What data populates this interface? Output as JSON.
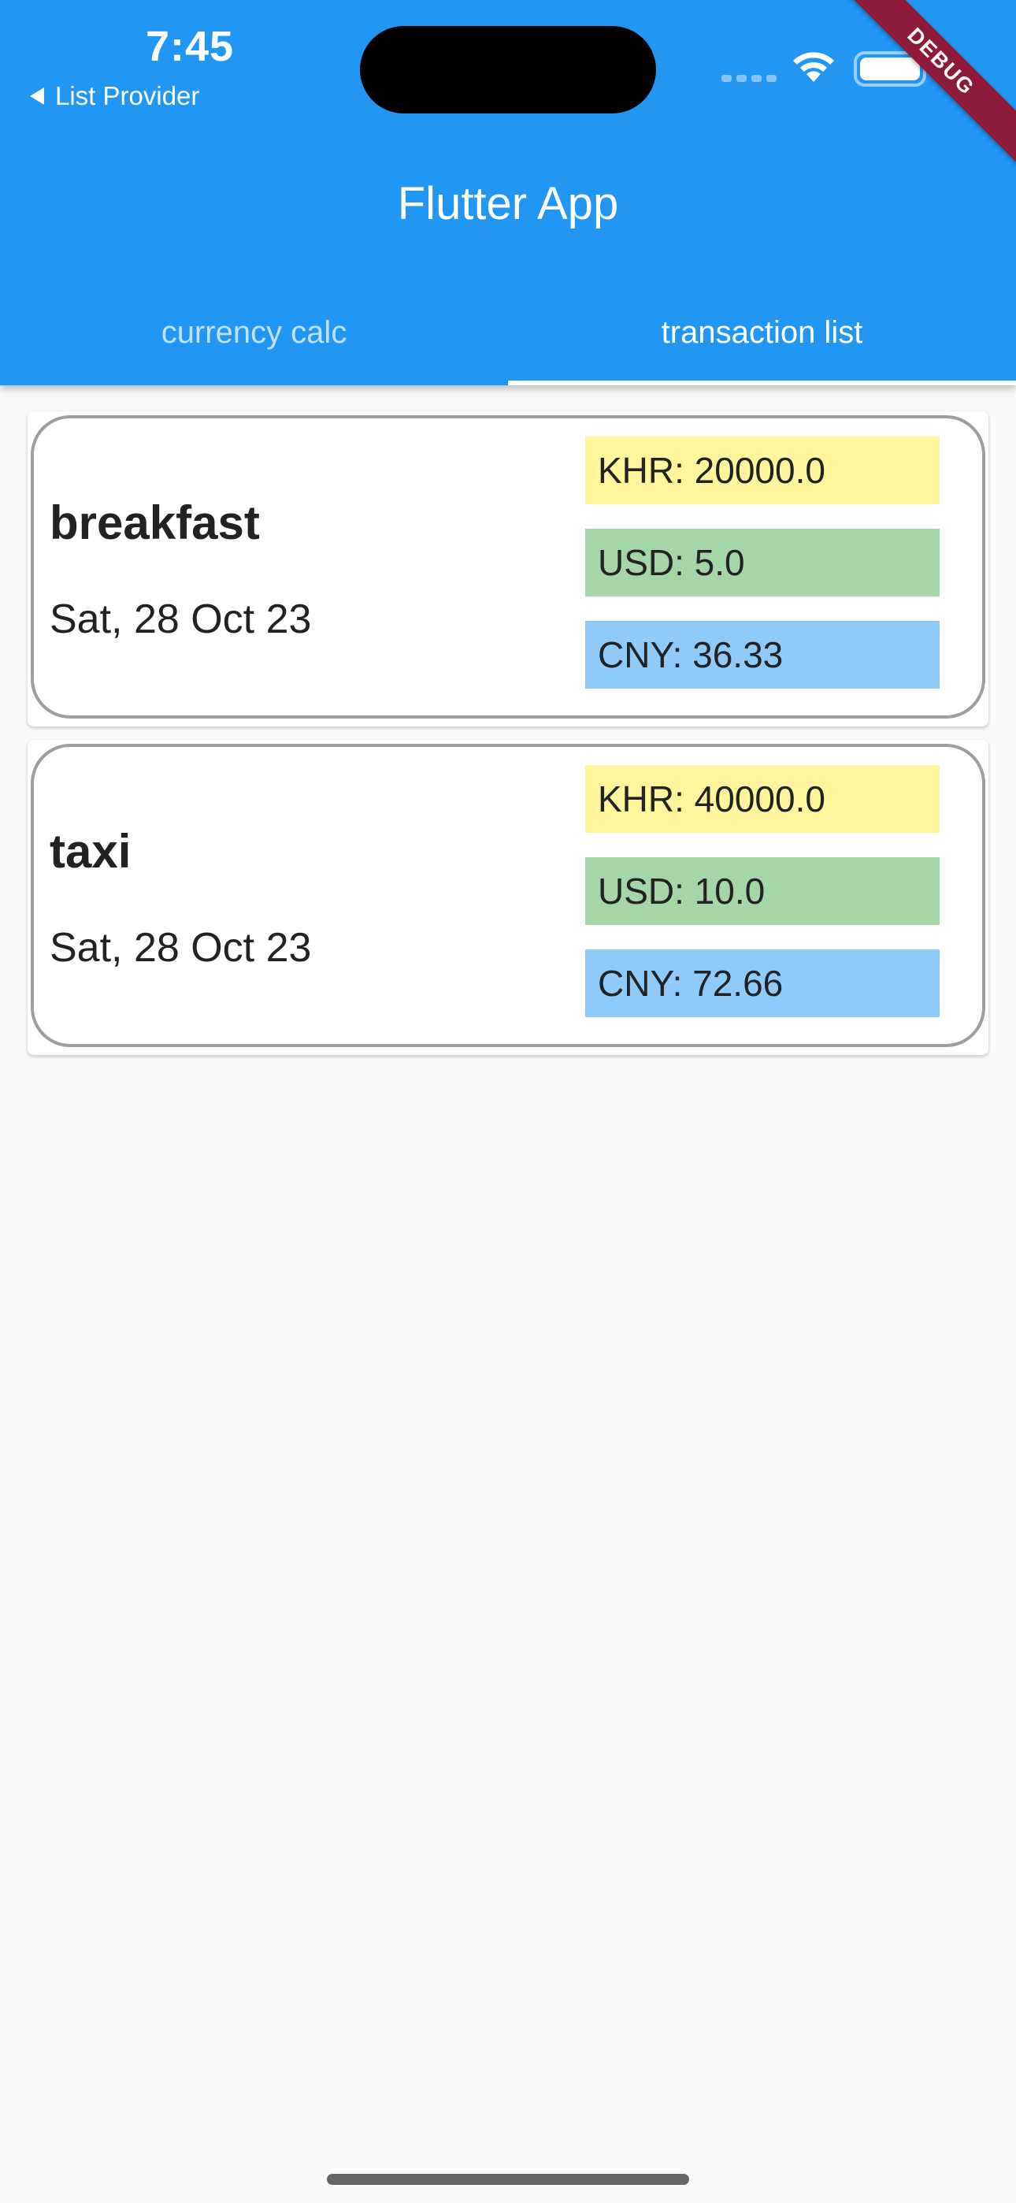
{
  "status_bar": {
    "time": "7:45",
    "back_label": "List Provider"
  },
  "app_bar": {
    "title": "Flutter App",
    "color": "#2196f3"
  },
  "tabs": [
    {
      "label": "currency calc",
      "active": false
    },
    {
      "label": "transaction list",
      "active": true
    }
  ],
  "debug_banner": "DEBUG",
  "transactions": [
    {
      "name": "breakfast",
      "date": "Sat, 28 Oct 23",
      "khr": "KHR: 20000.0",
      "usd": "USD: 5.0",
      "cny": "CNY: 36.33"
    },
    {
      "name": "taxi",
      "date": "Sat, 28 Oct 23",
      "khr": "KHR: 40000.0",
      "usd": "USD: 10.0",
      "cny": "CNY: 72.66"
    }
  ],
  "colors": {
    "khr": "#fff59d",
    "usd": "#a5d6a7",
    "cny": "#90caf9",
    "debug": "#8e1a3b"
  }
}
